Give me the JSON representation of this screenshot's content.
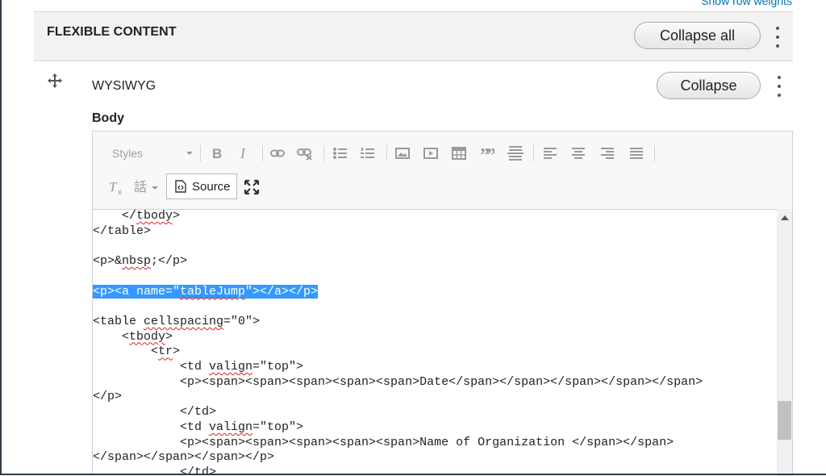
{
  "header": {
    "top_link": "Show row weights",
    "section_title": "FLEXIBLE CONTENT",
    "collapse_all_label": "Collapse all"
  },
  "paragraph": {
    "title": "WYSIWYG",
    "collapse_label": "Collapse",
    "field_label": "Body"
  },
  "toolbar": {
    "styles_label": "Styles",
    "source_label": "Source",
    "icons": [
      "bold-icon",
      "italic-icon",
      "link-icon",
      "unlink-icon",
      "bulleted-list-icon",
      "numbered-list-icon",
      "image-icon",
      "media-icon",
      "table-icon",
      "blockquote-icon",
      "horizontal-rule-icon",
      "align-left-icon",
      "align-center-icon",
      "align-right-icon",
      "justify-icon",
      "remove-format-icon",
      "language-icon",
      "source-icon",
      "maximize-icon"
    ]
  },
  "code_lines": [
    {
      "pre": "    </",
      "sq": "tbody",
      "post": ">"
    },
    {
      "pre": "</table>"
    },
    {
      "pre": ""
    },
    {
      "pre": "<p>&",
      "sq": "nbsp",
      "post": ";</p>"
    },
    {
      "pre": ""
    },
    {
      "hl": "<p><a name=\"tableJump\"></a></p>",
      "sq_in_hl": "tableJump"
    },
    {
      "pre": ""
    },
    {
      "pre": "<table ",
      "sq": "cellspacing",
      "post": "=\"0\">"
    },
    {
      "pre": "    <",
      "sq": "tbody",
      "post": ">"
    },
    {
      "pre": "        <",
      "sq": "tr",
      "post": ">"
    },
    {
      "pre": "            <td ",
      "sq": "valign",
      "post": "=\"top\">"
    },
    {
      "pre": "            <p><span><span><span><span><span>Date</span></span></span></span></span>"
    },
    {
      "pre": "</p>"
    },
    {
      "pre": "            </td>"
    },
    {
      "pre": "            <td ",
      "sq": "valign",
      "post": "=\"top\">"
    },
    {
      "pre": "            <p><span><span><span><span><span>Name of Organization </span></span>"
    },
    {
      "pre": "</span></span></span></p>"
    },
    {
      "pre": "            </td>"
    }
  ],
  "colors": {
    "link": "#0071b8",
    "header_bg": "#f2f2f0",
    "selection": "#3399ff",
    "spellcheck": "#e02020"
  }
}
